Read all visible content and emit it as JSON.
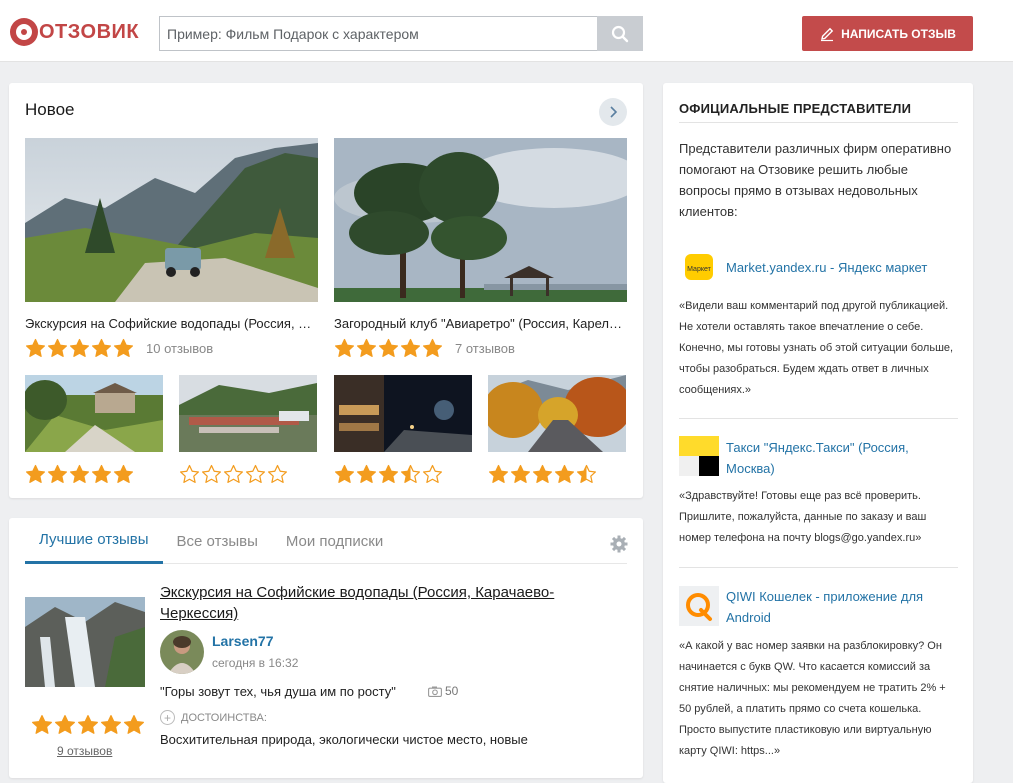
{
  "header": {
    "logo_text": "ОТЗОВИК",
    "search_placeholder": "Пример: Фильм Подарок с характером",
    "write_review_label": "НАПИСАТЬ ОТЗЫВ"
  },
  "new_section": {
    "title": "Новое",
    "featured": [
      {
        "caption": "Экскурсия на Софийские водопады (Россия, Карачаево-Черкессия)",
        "rating": 5,
        "count_label": "10 отзывов"
      },
      {
        "caption": "Загородный клуб \"Авиаретро\" (Россия, Карелия)",
        "rating": 5,
        "count_label": "7 отзывов"
      }
    ],
    "small": [
      {
        "rating": 5
      },
      {
        "rating": 0
      },
      {
        "rating": 3.5
      },
      {
        "rating": 4.5
      }
    ]
  },
  "reviews": {
    "tabs": [
      "Лучшие отзывы",
      "Все отзывы",
      "Мои подписки"
    ],
    "active_tab": 0,
    "item": {
      "title": "Экскурсия на Софийские водопады (Россия, Карачаево-Черкессия)",
      "author": "Larsen77",
      "date": "сегодня в 16:32",
      "quote": "\"Горы зовут тех, чья душа им по росту\"",
      "photos": "50",
      "rating": 5,
      "count_label": "9 отзывов",
      "pros_label": "ДОСТОИНСТВА:",
      "pros_text": "Восхитительная природа, экологически чистое место, новые"
    }
  },
  "sidebar": {
    "title": "ОФИЦИАЛЬНЫЕ ПРЕДСТАВИТЕЛИ",
    "intro": "Представители различных фирм оперативно помогают на Отзовике решить любые вопросы прямо в отзывах недовольных клиентов:",
    "reps": [
      {
        "name": "Market.yandex.ru - Яндекс маркет",
        "logo_text": "Маркет",
        "quote": "«Видели ваш комментарий под другой публикацией. Не хотели оставлять такое впечатление о себе. Конечно, мы готовы узнать об этой ситуации больше, чтобы разобраться. Будем ждать ответ в личных сообщениях.»"
      },
      {
        "name": "Такси \"Яндекс.Такси\" (Россия, Москва)",
        "quote": "«Здравствуйте! Готовы еще раз всё проверить. Пришлите, пожалуйста, данные по заказу и ваш номер телефона на почту blogs@go.yandex.ru»"
      },
      {
        "name": "QIWI Кошелек - приложение для Android",
        "quote": "«А какой у вас номер заявки на разблокировку? Он начинается с букв QW. Что касается комиссий за снятие наличных: мы рекомендуем не тратить 2% + 50 рублей, а платить прямо со счета кошелька. Просто выпустите пластиковую или виртуальную карту QIWI: https...»"
      }
    ]
  },
  "colors": {
    "accent_red": "#c34b4b",
    "link_blue": "#2373a6",
    "star_orange": "#f39c1e"
  }
}
